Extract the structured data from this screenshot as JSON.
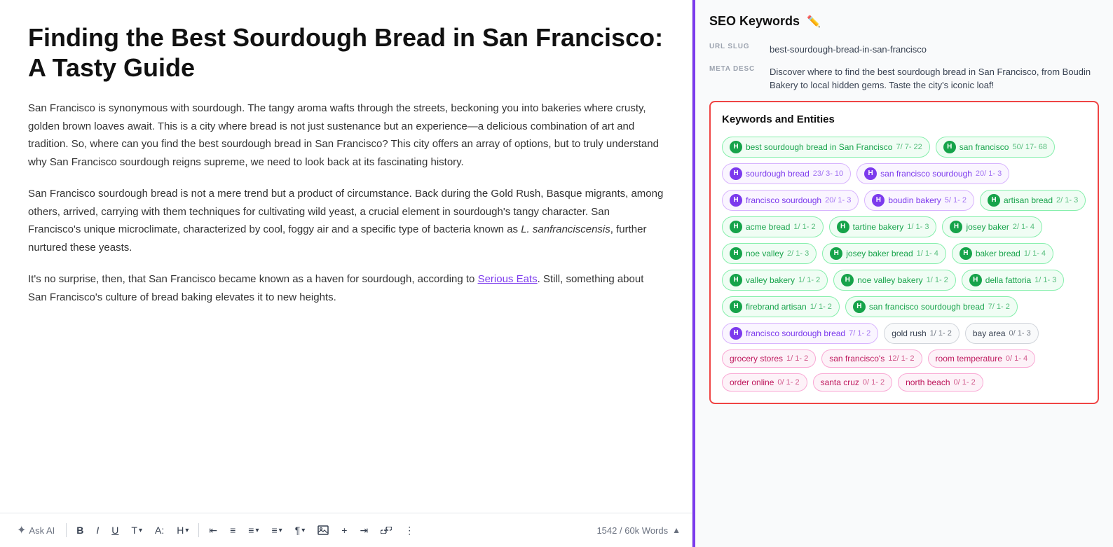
{
  "left": {
    "title": "Finding the Best Sourdough Bread in San Francisco: A Tasty Guide",
    "paragraphs": [
      "San Francisco is synonymous with sourdough. The tangy aroma wafts through the streets, beckoning you into bakeries where crusty, golden brown loaves await. This is a city where bread is not just sustenance but an experience—a delicious combination of art and tradition. So, where can you find the best sourdough bread in San Francisco? This city offers an array of options, but to truly understand why San Francisco sourdough reigns supreme, we need to look back at its fascinating history.",
      "San Francisco sourdough bread is not a mere trend but a product of circumstance. Back during the Gold Rush, Basque migrants, among others, arrived, carrying with them techniques for cultivating wild yeast, a crucial element in sourdough's tangy character. San Francisco's unique microclimate, characterized by cool, foggy air and a specific type of bacteria known as L. sanfranciscensis, further nurtured these yeasts.",
      "It's no surprise, then, that San Francisco became known as a haven for sourdough, according to Serious Eats. Still, something about San Francisco's culture of bread baking elevates it to new heights."
    ],
    "toolbar": {
      "ask_ai": "Ask AI",
      "bold": "B",
      "italic": "I",
      "underline": "U",
      "text_format": "T",
      "font_size": "A:",
      "heading": "H",
      "align_left": "≡",
      "align_center": "≡",
      "list": "≡",
      "bullet": "≡",
      "paragraph": "¶",
      "image": "🖼",
      "plus": "+",
      "text_dir": "⇥",
      "link": "🔗",
      "more": "⋮"
    },
    "word_count": "1542 / 60k Words"
  },
  "right": {
    "seo_title": "SEO Keywords",
    "url_slug_label": "URL SLUG",
    "url_slug_value": "best-sourdough-bread-in-san-francisco",
    "meta_desc_label": "META DESC",
    "meta_desc_value": "Discover where to find the best sourdough bread in San Francisco, from Boudin Bakery to local hidden gems. Taste the city's iconic loaf!",
    "keywords_title": "Keywords and Entities",
    "keywords": [
      {
        "badge": "H",
        "badge_type": "green",
        "chip_type": "green",
        "text": "best sourdough bread in San Francisco",
        "stats": "7/ 7- 22"
      },
      {
        "badge": "H",
        "badge_type": "green",
        "chip_type": "green",
        "text": "san francisco",
        "stats": "50/ 17- 68"
      },
      {
        "badge": "H",
        "badge_type": "purple",
        "chip_type": "purple",
        "text": "sourdough bread",
        "stats": "23/ 3- 10"
      },
      {
        "badge": "H",
        "badge_type": "purple",
        "chip_type": "purple",
        "text": "san francisco sourdough",
        "stats": "20/ 1- 3"
      },
      {
        "badge": "H",
        "badge_type": "purple",
        "chip_type": "purple",
        "text": "francisco sourdough",
        "stats": "20/ 1- 3"
      },
      {
        "badge": "H",
        "badge_type": "purple",
        "chip_type": "purple",
        "text": "boudin bakery",
        "stats": "5/ 1- 2"
      },
      {
        "badge": "H",
        "badge_type": "green",
        "chip_type": "green",
        "text": "artisan bread",
        "stats": "2/ 1- 3"
      },
      {
        "badge": "H",
        "badge_type": "green",
        "chip_type": "green",
        "text": "acme bread",
        "stats": "1/ 1- 2"
      },
      {
        "badge": "H",
        "badge_type": "green",
        "chip_type": "green",
        "text": "tartine bakery",
        "stats": "1/ 1- 3"
      },
      {
        "badge": "H",
        "badge_type": "green",
        "chip_type": "green",
        "text": "josey baker",
        "stats": "2/ 1- 4"
      },
      {
        "badge": "H",
        "badge_type": "green",
        "chip_type": "green",
        "text": "noe valley",
        "stats": "2/ 1- 3"
      },
      {
        "badge": "H",
        "badge_type": "green",
        "chip_type": "green",
        "text": "josey baker bread",
        "stats": "1/ 1- 4"
      },
      {
        "badge": "H",
        "badge_type": "green",
        "chip_type": "green",
        "text": "baker bread",
        "stats": "1/ 1- 4"
      },
      {
        "badge": "H",
        "badge_type": "green",
        "chip_type": "green",
        "text": "valley bakery",
        "stats": "1/ 1- 2"
      },
      {
        "badge": "H",
        "badge_type": "green",
        "chip_type": "green",
        "text": "noe valley bakery",
        "stats": "1/ 1- 2"
      },
      {
        "badge": "H",
        "badge_type": "green",
        "chip_type": "green",
        "text": "della fattoria",
        "stats": "1/ 1- 3"
      },
      {
        "badge": "H",
        "badge_type": "green",
        "chip_type": "green",
        "text": "firebrand artisan",
        "stats": "1/ 1- 2"
      },
      {
        "badge": "H",
        "badge_type": "green",
        "chip_type": "green",
        "text": "san francisco sourdough bread",
        "stats": "7/ 1- 2"
      },
      {
        "badge": "H",
        "badge_type": "purple",
        "chip_type": "purple",
        "text": "francisco sourdough bread",
        "stats": "7/ 1- 2"
      },
      {
        "badge": null,
        "chip_type": "gray",
        "text": "gold rush",
        "stats": "1/ 1- 2"
      },
      {
        "badge": null,
        "chip_type": "gray",
        "text": "bay area",
        "stats": "0/ 1- 3"
      },
      {
        "badge": null,
        "chip_type": "pink",
        "text": "grocery stores",
        "stats": "1/ 1- 2"
      },
      {
        "badge": null,
        "chip_type": "pink",
        "text": "san francisco's",
        "stats": "12/ 1- 2"
      },
      {
        "badge": null,
        "chip_type": "pink",
        "text": "room temperature",
        "stats": "0/ 1- 4"
      },
      {
        "badge": null,
        "chip_type": "pink",
        "text": "order online",
        "stats": "0/ 1- 2"
      },
      {
        "badge": null,
        "chip_type": "pink",
        "text": "santa cruz",
        "stats": "0/ 1- 2"
      },
      {
        "badge": null,
        "chip_type": "pink",
        "text": "north beach",
        "stats": "0/ 1- 2"
      }
    ]
  }
}
